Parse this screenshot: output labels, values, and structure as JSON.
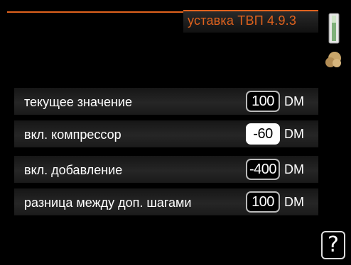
{
  "header": {
    "title": "уставка ТВП  4.9.3"
  },
  "icons": {
    "thermometer": "thermometer-icon",
    "mode": "comfort-mode-icon",
    "help": "help-icon"
  },
  "help": {
    "label": "?"
  },
  "colors": {
    "accent": "#e0621d",
    "background": "#000000",
    "text": "#ffffff"
  },
  "rows": [
    {
      "label": "текущее значение",
      "value": "100",
      "unit": "DM",
      "selected": false
    },
    {
      "label": "вкл. компрессор",
      "value": "-60",
      "unit": "DM",
      "selected": true
    },
    {
      "label": "вкл. добавление",
      "value": "-400",
      "unit": "DM",
      "selected": false
    },
    {
      "label": "разница между доп. шагами",
      "value": "100",
      "unit": "DM",
      "selected": false
    }
  ]
}
